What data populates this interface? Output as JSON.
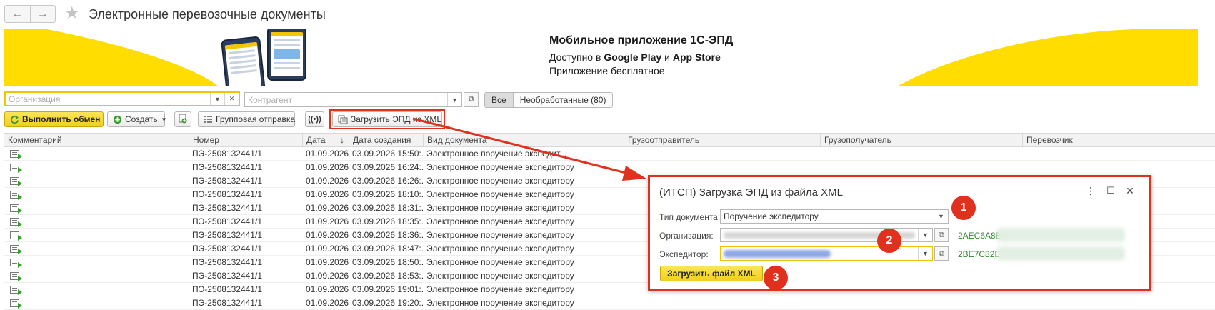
{
  "window": {
    "title": "Электронные перевозочные документы"
  },
  "banner": {
    "headline": "Мобильное приложение 1С-ЭПД",
    "available_prefix": "Доступно в ",
    "store1": "Google Play",
    "and": " и ",
    "store2": "App Store",
    "free_text": "Приложение бесплатное"
  },
  "filters": {
    "organization_placeholder": "Организация",
    "counterparty_placeholder": "Контрагент",
    "seg_all": "Все",
    "seg_unprocessed": "Необработанные (80)"
  },
  "toolbar": {
    "exchange": "Выполнить обмен",
    "create": "Создать",
    "group_send": "Групповая отправка",
    "upload_xml": "Загрузить ЭПД из XML"
  },
  "table": {
    "columns": [
      "Комментарий",
      "Номер",
      "Дата",
      "Дата создания",
      "Вид документа",
      "Грузоотправитель",
      "Грузополучатель",
      "Перевозчик"
    ],
    "rows": [
      {
        "number": "ПЭ-2508132441/1",
        "date": "01.09.2026",
        "created": "03.09.2026 15:50:...",
        "type": "Электронное поручение экспедит..."
      },
      {
        "number": "ПЭ-2508132441/1",
        "date": "01.09.2026",
        "created": "03.09.2026 16:24:...",
        "type": "Электронное поручение экспедитору"
      },
      {
        "number": "ПЭ-2508132441/1",
        "date": "01.09.2026",
        "created": "03.09.2026 16:26:...",
        "type": "Электронное поручение экспедитору"
      },
      {
        "number": "ПЭ-2508132441/1",
        "date": "01.09.2026",
        "created": "03.09.2026 18:10:...",
        "type": "Электронное поручение экспедитору"
      },
      {
        "number": "ПЭ-2508132441/1",
        "date": "01.09.2026",
        "created": "03.09.2026 18:31:...",
        "type": "Электронное поручение экспедитору"
      },
      {
        "number": "ПЭ-2508132441/1",
        "date": "01.09.2026",
        "created": "03.09.2026 18:35:...",
        "type": "Электронное поручение экспедитору"
      },
      {
        "number": "ПЭ-2508132441/1",
        "date": "01.09.2026",
        "created": "03.09.2026 18:36:...",
        "type": "Электронное поручение экспедитору"
      },
      {
        "number": "ПЭ-2508132441/1",
        "date": "01.09.2026",
        "created": "03.09.2026 18:47:...",
        "type": "Электронное поручение экспедитору"
      },
      {
        "number": "ПЭ-2508132441/1",
        "date": "01.09.2026",
        "created": "03.09.2026 18:50:...",
        "type": "Электронное поручение экспедитору"
      },
      {
        "number": "ПЭ-2508132441/1",
        "date": "01.09.2026",
        "created": "03.09.2026 18:53:...",
        "type": "Электронное поручение экспедитору"
      },
      {
        "number": "ПЭ-2508132441/1",
        "date": "01.09.2026",
        "created": "03.09.2026 19:01:...",
        "type": "Электронное поручение экспедитору"
      },
      {
        "number": "ПЭ-2508132441/1",
        "date": "01.09.2026",
        "created": "03.09.2026 19:20:...",
        "type": "Электронное поручение экспедитору"
      }
    ]
  },
  "dialog": {
    "title": "(ИТСП) Загрузка ЭПД из файла XML",
    "doc_type_label": "Тип документа:",
    "doc_type_value": "Поручение экспедитору",
    "org_label": "Организация:",
    "org_code": "2AEC6A8B",
    "forwarder_label": "Экспедитор:",
    "forwarder_code": "2BE7C82E",
    "load_button": "Загрузить файл XML",
    "more_icon": "⋮",
    "max_icon": "☐",
    "close_icon": "✕"
  },
  "callouts": [
    "1",
    "2",
    "3"
  ],
  "colors": {
    "accent": "#ffdd00",
    "highlight": "#e0311f",
    "code_green": "#2c8a2c"
  }
}
